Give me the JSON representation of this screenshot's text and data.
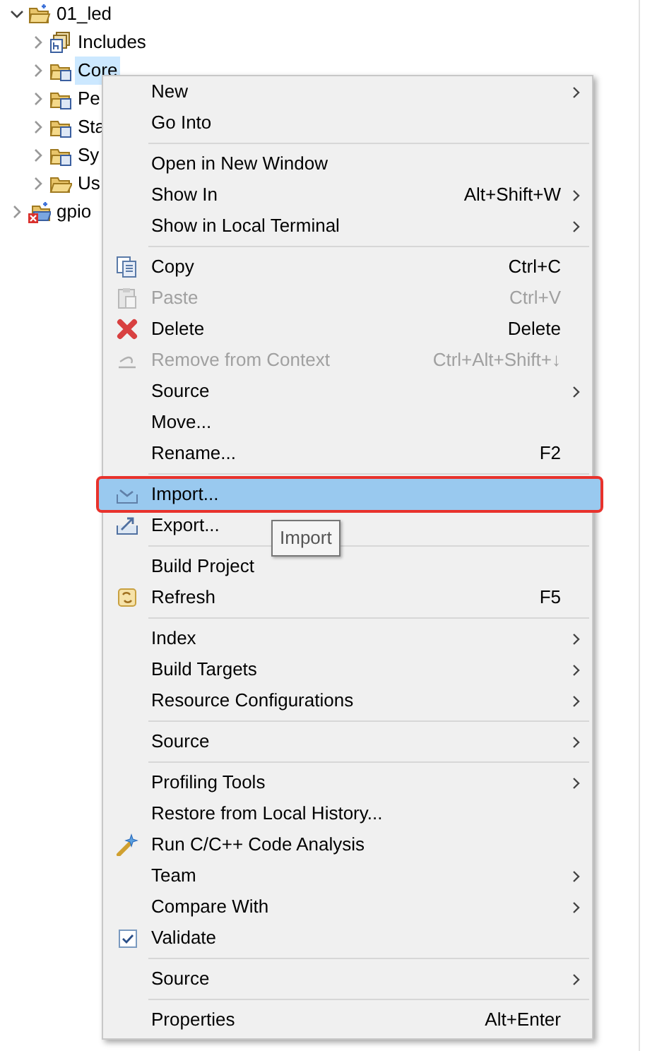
{
  "tree": [
    {
      "label": "01_led",
      "kind": "project",
      "expanded": true,
      "selected": false,
      "children": [
        {
          "label": "Includes",
          "kind": "includes",
          "expanded": false,
          "selected": false
        },
        {
          "label": "Core",
          "kind": "source-folder",
          "expanded": false,
          "selected": true
        },
        {
          "label": "Pe",
          "kind": "source-folder",
          "expanded": false,
          "selected": false
        },
        {
          "label": "Sta",
          "kind": "source-folder",
          "expanded": false,
          "selected": false
        },
        {
          "label": "Sy",
          "kind": "source-folder",
          "expanded": false,
          "selected": false
        },
        {
          "label": "Us",
          "kind": "folder",
          "expanded": false,
          "selected": false
        }
      ]
    },
    {
      "label": "gpio",
      "kind": "project-error",
      "expanded": false,
      "selected": false
    }
  ],
  "context_menu": [
    [
      {
        "label": "New",
        "submenu": true,
        "disabled": false,
        "selected": false
      },
      {
        "label": "Go Into",
        "submenu": false,
        "disabled": false,
        "selected": false
      }
    ],
    [
      {
        "label": "Open in New Window",
        "submenu": false,
        "disabled": false,
        "selected": false
      },
      {
        "label": "Show In",
        "shortcut": "Alt+Shift+W",
        "submenu": true,
        "disabled": false,
        "selected": false
      },
      {
        "label": "Show in Local Terminal",
        "submenu": true,
        "disabled": false,
        "selected": false
      }
    ],
    [
      {
        "label": "Copy",
        "shortcut": "Ctrl+C",
        "kind": "copy",
        "submenu": false,
        "disabled": false,
        "selected": false
      },
      {
        "label": "Paste",
        "shortcut": "Ctrl+V",
        "kind": "paste",
        "submenu": false,
        "disabled": true,
        "selected": false
      },
      {
        "label": "Delete",
        "shortcut": "Delete",
        "kind": "delete",
        "submenu": false,
        "disabled": false,
        "selected": false
      },
      {
        "label": "Remove from Context",
        "shortcut": "Ctrl+Alt+Shift+↓",
        "kind": "remove",
        "submenu": false,
        "disabled": true,
        "selected": false
      },
      {
        "label": "Source",
        "submenu": true,
        "disabled": false,
        "selected": false
      },
      {
        "label": "Move...",
        "submenu": false,
        "disabled": false,
        "selected": false
      },
      {
        "label": "Rename...",
        "shortcut": "F2",
        "submenu": false,
        "disabled": false,
        "selected": false
      }
    ],
    [
      {
        "label": "Import...",
        "kind": "import",
        "submenu": false,
        "disabled": false,
        "selected": true
      },
      {
        "label": "Export...",
        "kind": "export",
        "submenu": false,
        "disabled": false,
        "selected": false
      }
    ],
    [
      {
        "label": "Build Project",
        "submenu": false,
        "disabled": false,
        "selected": false
      },
      {
        "label": "Refresh",
        "shortcut": "F5",
        "kind": "refresh",
        "submenu": false,
        "disabled": false,
        "selected": false
      }
    ],
    [
      {
        "label": "Index",
        "submenu": true,
        "disabled": false,
        "selected": false
      },
      {
        "label": "Build Targets",
        "submenu": true,
        "disabled": false,
        "selected": false
      },
      {
        "label": "Resource Configurations",
        "submenu": true,
        "disabled": false,
        "selected": false
      }
    ],
    [
      {
        "label": "Source",
        "submenu": true,
        "disabled": false,
        "selected": false
      }
    ],
    [
      {
        "label": "Profiling Tools",
        "submenu": true,
        "disabled": false,
        "selected": false
      },
      {
        "label": "Restore from Local History...",
        "submenu": false,
        "disabled": false,
        "selected": false
      },
      {
        "label": "Run C/C++ Code Analysis",
        "kind": "analysis",
        "submenu": false,
        "disabled": false,
        "selected": false
      },
      {
        "label": "Team",
        "submenu": true,
        "disabled": false,
        "selected": false
      },
      {
        "label": "Compare With",
        "submenu": true,
        "disabled": false,
        "selected": false
      },
      {
        "label": "Validate",
        "checked": true,
        "submenu": false,
        "disabled": false,
        "selected": false
      }
    ],
    [
      {
        "label": "Source",
        "submenu": true,
        "disabled": false,
        "selected": false
      }
    ],
    [
      {
        "label": "Properties",
        "shortcut": "Alt+Enter",
        "submenu": false,
        "disabled": false,
        "selected": false
      }
    ]
  ],
  "tooltip": "Import"
}
